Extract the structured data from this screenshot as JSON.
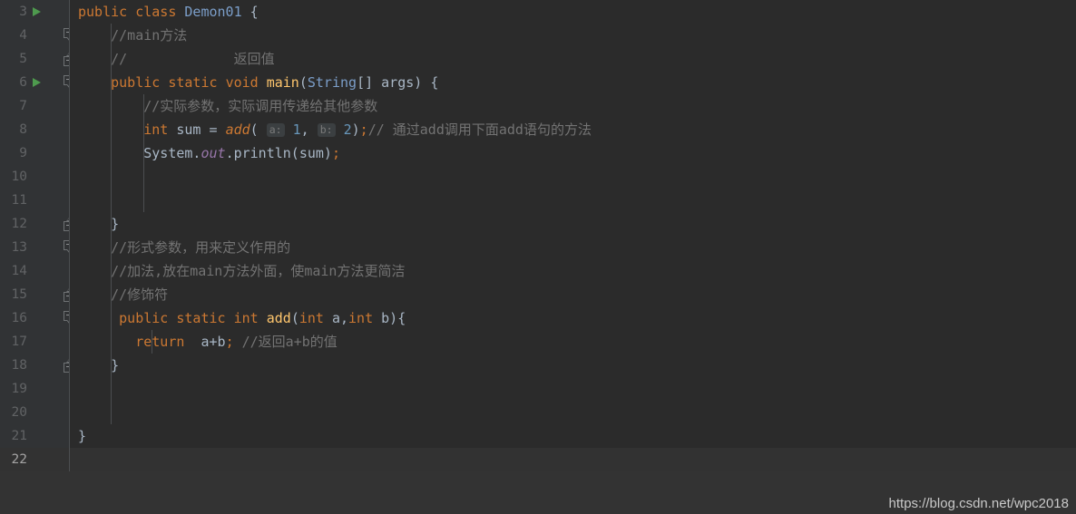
{
  "editor": {
    "theme_name": "Darcula",
    "language": "Java",
    "background_color": "#2b2b2b",
    "gutter_color": "#313335",
    "current_line": 22,
    "first_visible_line": 3,
    "last_visible_line": 22
  },
  "gutter": {
    "line_numbers": [
      "3",
      "4",
      "5",
      "6",
      "7",
      "8",
      "9",
      "10",
      "11",
      "12",
      "13",
      "14",
      "15",
      "16",
      "17",
      "18",
      "19",
      "20",
      "21",
      "22"
    ],
    "run_arrow_lines": [
      3,
      6
    ],
    "fold_markers": [
      {
        "line": 4,
        "type": "down"
      },
      {
        "line": 5,
        "type": "up"
      },
      {
        "line": 6,
        "type": "down"
      },
      {
        "line": 12,
        "type": "up"
      },
      {
        "line": 13,
        "type": "down"
      },
      {
        "line": 15,
        "type": "up"
      },
      {
        "line": 16,
        "type": "down"
      },
      {
        "line": 18,
        "type": "up"
      }
    ]
  },
  "code": {
    "lines": [
      {
        "number": "3",
        "tokens": [
          {
            "text": "public",
            "kind": "kw"
          },
          {
            "text": " ",
            "kind": "plain"
          },
          {
            "text": "class",
            "kind": "kw"
          },
          {
            "text": " ",
            "kind": "plain"
          },
          {
            "text": "Demon01",
            "kind": "type"
          },
          {
            "text": " {",
            "kind": "punc"
          }
        ]
      },
      {
        "number": "4",
        "tokens": [
          {
            "text": "    //main方法",
            "kind": "cmt"
          }
        ]
      },
      {
        "number": "5",
        "tokens": [
          {
            "text": "    //             返回值",
            "kind": "cmt"
          }
        ]
      },
      {
        "number": "6",
        "tokens": [
          {
            "text": "    ",
            "kind": "plain"
          },
          {
            "text": "public",
            "kind": "kw"
          },
          {
            "text": " ",
            "kind": "plain"
          },
          {
            "text": "static",
            "kind": "kw"
          },
          {
            "text": " ",
            "kind": "plain"
          },
          {
            "text": "void",
            "kind": "kw"
          },
          {
            "text": " ",
            "kind": "plain"
          },
          {
            "text": "main",
            "kind": "mth"
          },
          {
            "text": "(",
            "kind": "punc"
          },
          {
            "text": "String",
            "kind": "type"
          },
          {
            "text": "[] args) {",
            "kind": "punc"
          }
        ]
      },
      {
        "number": "7",
        "tokens": [
          {
            "text": "        //实际参数，实际调用传递给其他参数",
            "kind": "cmt"
          }
        ]
      },
      {
        "number": "8",
        "tokens": [
          {
            "text": "        ",
            "kind": "plain"
          },
          {
            "text": "int",
            "kind": "kw"
          },
          {
            "text": " sum = ",
            "kind": "plain"
          },
          {
            "text": "add",
            "kind": "mcall"
          },
          {
            "text": "( ",
            "kind": "punc"
          },
          {
            "text": "a:",
            "kind": "hint"
          },
          {
            "text": " ",
            "kind": "plain"
          },
          {
            "text": "1",
            "kind": "num"
          },
          {
            "text": ", ",
            "kind": "punc"
          },
          {
            "text": "b:",
            "kind": "hint"
          },
          {
            "text": " ",
            "kind": "plain"
          },
          {
            "text": "2",
            "kind": "num"
          },
          {
            "text": ")",
            "kind": "punc"
          },
          {
            "text": ";",
            "kind": "semi"
          },
          {
            "text": "// 通过add调用下面add语句的方法",
            "kind": "cmt"
          }
        ]
      },
      {
        "number": "9",
        "tokens": [
          {
            "text": "        System.",
            "kind": "plain"
          },
          {
            "text": "out",
            "kind": "field"
          },
          {
            "text": ".println(sum)",
            "kind": "plain"
          },
          {
            "text": ";",
            "kind": "semi"
          }
        ]
      },
      {
        "number": "10",
        "tokens": []
      },
      {
        "number": "11",
        "tokens": []
      },
      {
        "number": "12",
        "tokens": [
          {
            "text": "    }",
            "kind": "punc"
          }
        ]
      },
      {
        "number": "13",
        "tokens": [
          {
            "text": "    //形式参数，用来定义作用的",
            "kind": "cmt"
          }
        ]
      },
      {
        "number": "14",
        "tokens": [
          {
            "text": "    //加法,放在main方法外面，使main方法更简洁",
            "kind": "cmt"
          }
        ]
      },
      {
        "number": "15",
        "tokens": [
          {
            "text": "    //修饰符",
            "kind": "cmt"
          }
        ]
      },
      {
        "number": "16",
        "tokens": [
          {
            "text": "     ",
            "kind": "plain"
          },
          {
            "text": "public",
            "kind": "kw"
          },
          {
            "text": " ",
            "kind": "plain"
          },
          {
            "text": "static",
            "kind": "kw"
          },
          {
            "text": " ",
            "kind": "plain"
          },
          {
            "text": "int",
            "kind": "kw"
          },
          {
            "text": " ",
            "kind": "plain"
          },
          {
            "text": "add",
            "kind": "mth"
          },
          {
            "text": "(",
            "kind": "punc"
          },
          {
            "text": "int",
            "kind": "kw"
          },
          {
            "text": " a,",
            "kind": "plain"
          },
          {
            "text": "int",
            "kind": "kw"
          },
          {
            "text": " b){",
            "kind": "plain"
          }
        ]
      },
      {
        "number": "17",
        "tokens": [
          {
            "text": "       ",
            "kind": "plain"
          },
          {
            "text": "return",
            "kind": "kw"
          },
          {
            "text": "  a+b",
            "kind": "plain"
          },
          {
            "text": ";",
            "kind": "semi"
          },
          {
            "text": " //返回a+b的值",
            "kind": "cmt"
          }
        ]
      },
      {
        "number": "18",
        "tokens": [
          {
            "text": "    }",
            "kind": "punc"
          }
        ]
      },
      {
        "number": "19",
        "tokens": []
      },
      {
        "number": "20",
        "tokens": []
      },
      {
        "number": "21",
        "tokens": [
          {
            "text": "}",
            "kind": "punc"
          }
        ]
      },
      {
        "number": "22",
        "tokens": []
      }
    ]
  },
  "watermark": {
    "text": "https://blog.csdn.net/wpc2018"
  }
}
